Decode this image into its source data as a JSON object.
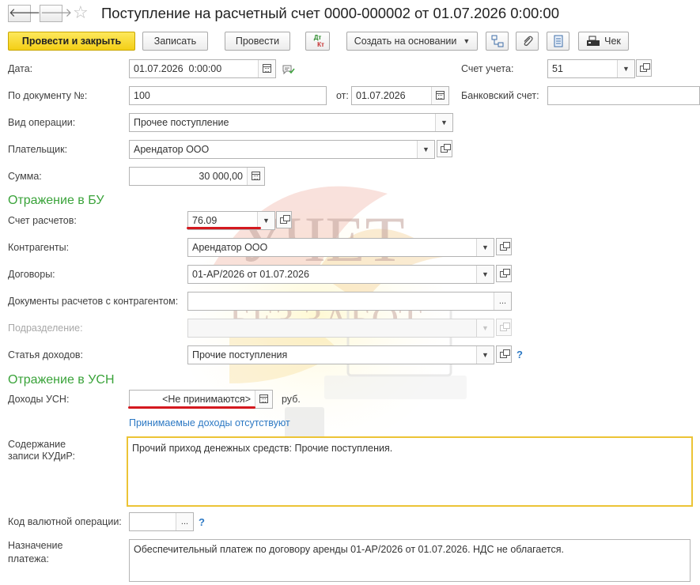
{
  "window": {
    "title": "Поступление на расчетный счет 0000-000002 от 01.07.2026 0:00:00"
  },
  "toolbar": {
    "post_close": "Провести и закрыть",
    "save": "Записать",
    "post": "Провести",
    "dtkt": "Дт Кт",
    "create_basis": "Создать на основании",
    "check": "Чек"
  },
  "form": {
    "date_label": "Дата:",
    "date_value": "01.07.2026  0:00:00",
    "account_label": "Счет учета:",
    "account_value": "51",
    "doc_no_label": "По документу №:",
    "doc_no_value": "100",
    "from_label": "от:",
    "from_value": "01.07.2026",
    "bank_account_label": "Банковский счет:",
    "bank_account_value": "",
    "operation_label": "Вид операции:",
    "operation_value": "Прочее поступление",
    "payer_label": "Плательщик:",
    "payer_value": "Арендатор ООО",
    "sum_label": "Сумма:",
    "sum_value": "30 000,00"
  },
  "bu": {
    "section_title": "Отражение в БУ",
    "settle_account_label": "Счет расчетов:",
    "settle_account_value": "76.09",
    "contractors_label": "Контрагенты:",
    "contractors_value": "Арендатор ООО",
    "contracts_label": "Договоры:",
    "contracts_value": "01-АР/2026 от 01.07.2026",
    "docs_label": "Документы расчетов с контрагентом:",
    "docs_value": "",
    "division_label": "Подразделение:",
    "division_value": "",
    "income_item_label": "Статья доходов:",
    "income_item_value": "Прочие поступления"
  },
  "usn": {
    "section_title": "Отражение в УСН",
    "income_label": "Доходы УСН:",
    "income_value": "<Не принимаются>",
    "currency": "руб.",
    "hint": "Принимаемые доходы отсутствуют",
    "kudir_label_1": "Содержание",
    "kudir_label_2": "записи КУДиР:",
    "kudir_value": "Прочий приход денежных средств: Прочие поступления."
  },
  "footer": {
    "currency_op_label": "Код валютной операции:",
    "currency_op_value": "",
    "purpose_label_1": "Назначение",
    "purpose_label_2": "платежа:",
    "purpose_value": "Обеспечительный платеж по договору аренды 01-АР/2026 от 01.07.2026. НДС не облагается."
  },
  "watermark": {
    "line1": "УЧЕТ",
    "line2": "БЕЗ ЗАБОТ"
  },
  "icons": {
    "back": "arrow-left-icon",
    "forward": "arrow-right-icon",
    "favorite": "star-icon",
    "structure": "document-structure-icon",
    "attach": "paperclip-icon",
    "report": "list-report-icon",
    "check": "cash-register-icon",
    "calendar": "calendar-icon",
    "calculator": "calculator-icon",
    "open": "open-form-icon",
    "dropdown": "chevron-down-icon",
    "select": "ellipsis-icon",
    "help": "question-icon",
    "comment": "comment-check-icon"
  }
}
